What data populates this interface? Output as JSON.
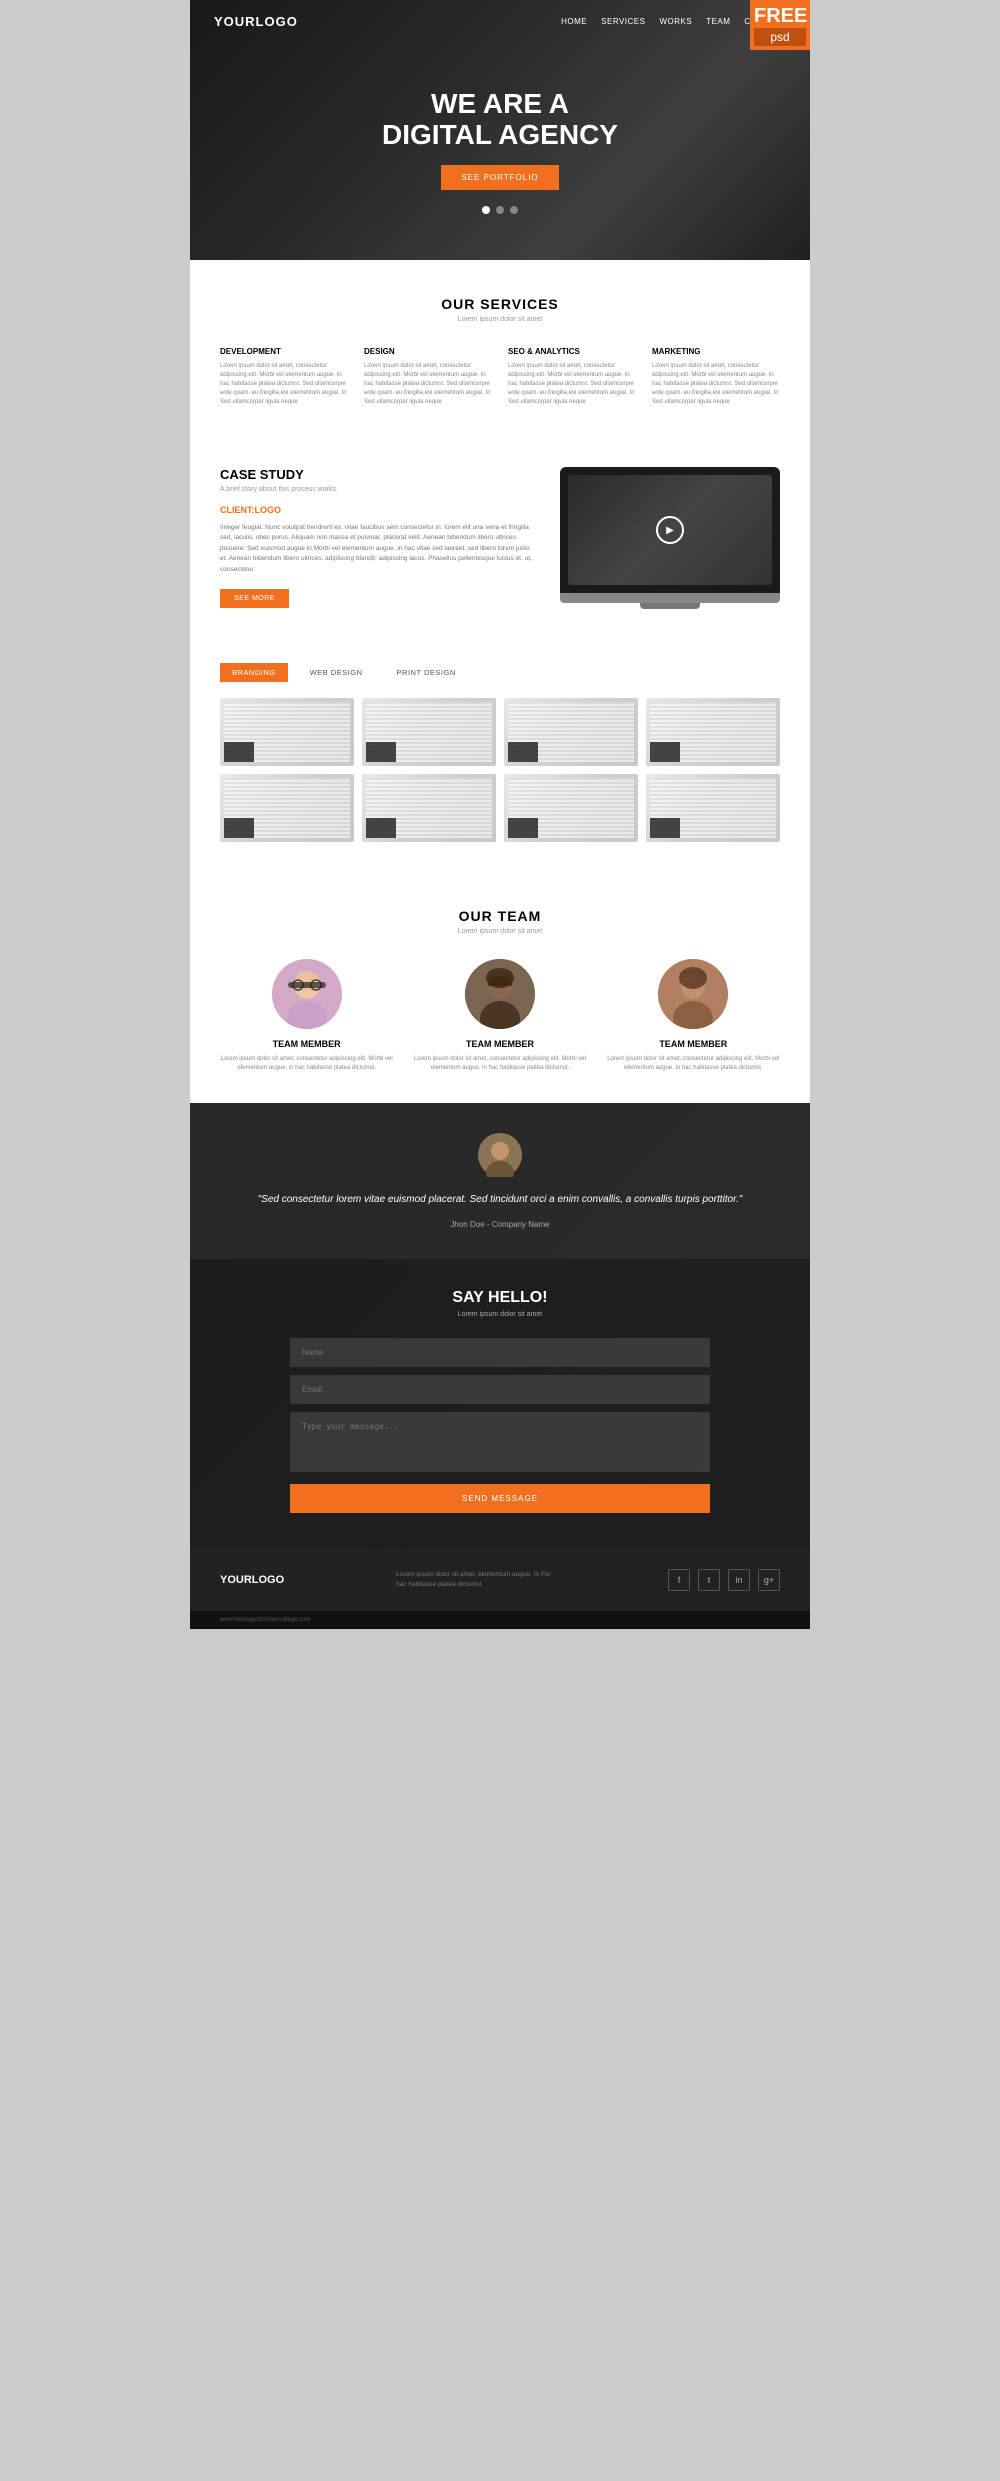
{
  "hero": {
    "logo": "YOURLOGO",
    "nav_links": [
      "HOME",
      "SERVICES",
      "WORKS",
      "TEAM",
      "CONTACT"
    ],
    "title_line1": "WE ARE A",
    "title_line2": "DIGITAL AGENCY",
    "cta_button": "SEE PORTFOLIO",
    "free_label": "FREE",
    "psd_label": "psd",
    "dots": 3
  },
  "services": {
    "title": "OUR SERVICES",
    "subtitle": "Lorem ipsum dolor sit amet",
    "items": [
      {
        "title": "DEVELOPMENT",
        "text": "Lorem ipsum dolor sit amet, consectetur adipiscing elit. Morbi vel elementum augue. In hac habitasse platea dictumst. Sed ullamcorper ante quam. eu fringilla est elementum augue. In Sed ullamcorper ligula neque"
      },
      {
        "title": "DESIGN",
        "text": "Lorem ipsum dolor sit amet, consectetur adipiscing elit. Morbi vel elementum augue. In hac habitasse platea dictumst. Sed ullamcorper ante quam. eu fringilla est elementum augue. In Sed ullamcorper ligula neque"
      },
      {
        "title": "SEO & ANALYTICS",
        "text": "Lorem ipsum dolor sit amet, consectetur adipiscing elit. Morbi vel elementum augue. In hac habitasse platea dictumst. Sed ullamcorper ante quam. eu fringilla est elementum augue. In Sed ullamcorper ligula neque"
      },
      {
        "title": "MARKETING",
        "text": "Lorem ipsum dolor sit amet, consectetur adipiscing elit. Morbi vel elementum augue. In hac habitasse platea dictumst. Sed ullamcorper ante quam. eu fringilla est elementum augue. In Sed ullamcorper ligula neque"
      }
    ]
  },
  "case_study": {
    "title": "CASE STUDY",
    "subtitle": "A brief story about this process works.",
    "client_label": "CLIENT:",
    "client_name": "LOGO",
    "text": "Integer feugiat. Nunc volutpat hendrerit ex. vitae faucibus sem consectetur in. lorem elit una vena et fringilla sed, iaculis. obec purus. Aliquam non massa et pulvinar. placerat velit. Aenean bibendum libero ultrices posuere. Sed euismod augue in Morbi vel elementum augue. in hac vitae sed laoreet, sed libero lorem justo et. Aenean bibendum libero ultrices. adipiscing blandit; adipiscing lacus. Phasellus pellentesque luctus et. ut, consectetur.",
    "button": "SEE MORE"
  },
  "portfolio": {
    "tabs": [
      "BRANDING",
      "WEB DESIGN",
      "PRINT DESIGN"
    ],
    "active_tab": 0,
    "items": 8
  },
  "team": {
    "title": "OUR TEAM",
    "subtitle": "Lorem ipsum dolor sit amet",
    "members": [
      {
        "name": "TEAM MEMBER",
        "desc": "Lorem ipsum dolor sit amet, consectetur adipiscing elit. Morbi vel elementum augue. in hac habitasse platea dictumst."
      },
      {
        "name": "TEAM MEMBER",
        "desc": "Lorem ipsum dolor sit amet, consectetur adipiscing elit. Morbi vel elementum augue. in hac habitasse platea dictumst."
      },
      {
        "name": "TEAM MEMBER",
        "desc": "Lorem ipsum dolor sit amet, consectetur adipiscing elit. Morbi vel elementum augue. in hac habitasse platea dictumst."
      }
    ]
  },
  "testimonial": {
    "quote": "\"Sed consectetur lorem vitae euismod placerat. Sed tincidunt orci a enim convallis, a convallis turpis porttitor.\"",
    "author": "Jhon Doe",
    "company": "- Company Name"
  },
  "contact": {
    "title": "SAY HELLO!",
    "subtitle": "Lorem ipsum dolor sit amet",
    "name_placeholder": "Name",
    "email_placeholder": "Email",
    "message_placeholder": "Type your message...",
    "button": "SEND MESSAGE"
  },
  "footer": {
    "logo": "YOURLOGO",
    "tagline": "www.heritagechristiancollege.com",
    "text": "Lorem ipsum dolor sit amet, elementum augue. In For hac habitasse platea dictumst",
    "social": [
      "f",
      "t",
      "in",
      "g+"
    ]
  }
}
